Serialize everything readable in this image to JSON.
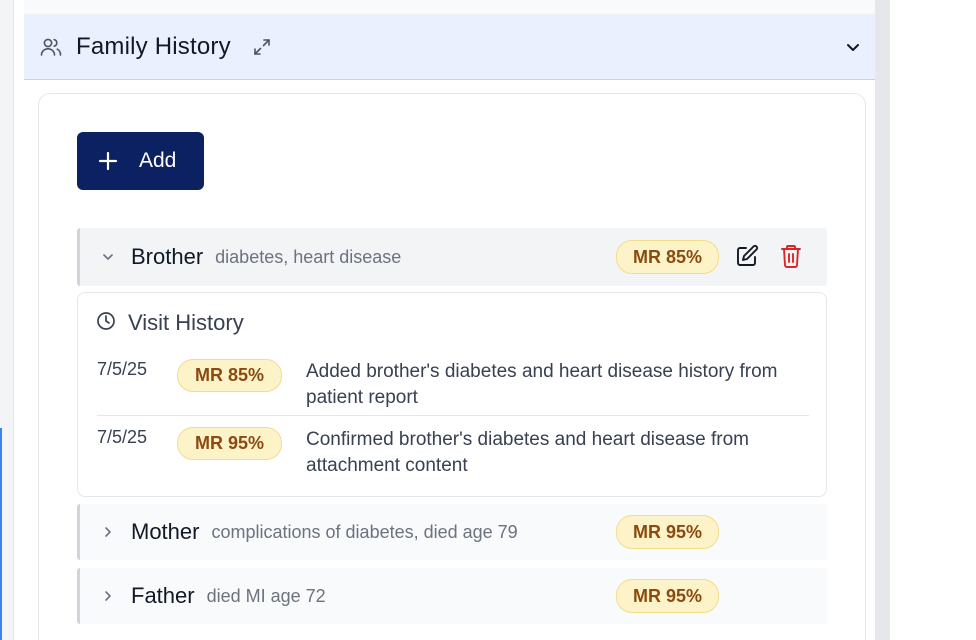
{
  "section": {
    "title": "Family History"
  },
  "add_button": {
    "label": "Add",
    "icon": "plus-icon"
  },
  "members": [
    {
      "relation": "Brother",
      "conditions": "diabetes, heart disease",
      "badge": "MR 85%",
      "expanded": true
    },
    {
      "relation": "Mother",
      "conditions": "complications of diabetes, died age 79",
      "badge": "MR 95%",
      "expanded": false
    },
    {
      "relation": "Father",
      "conditions": "died MI age 72",
      "badge": "MR 95%",
      "expanded": false
    }
  ],
  "visit_history": {
    "title": "Visit History",
    "entries": [
      {
        "date": "7/5/25",
        "badge": "MR 85%",
        "note": "Added brother's diabetes and heart disease history from patient report"
      },
      {
        "date": "7/5/25",
        "badge": "MR 95%",
        "note": "Confirmed brother's diabetes and heart disease from attachment content"
      }
    ]
  },
  "colors": {
    "header_bg": "#eaf0fd",
    "add_button_bg": "#0b2161",
    "badge_bg": "#fdf3c8",
    "badge_text": "#8a4a10",
    "delete_icon": "#dc2626"
  }
}
